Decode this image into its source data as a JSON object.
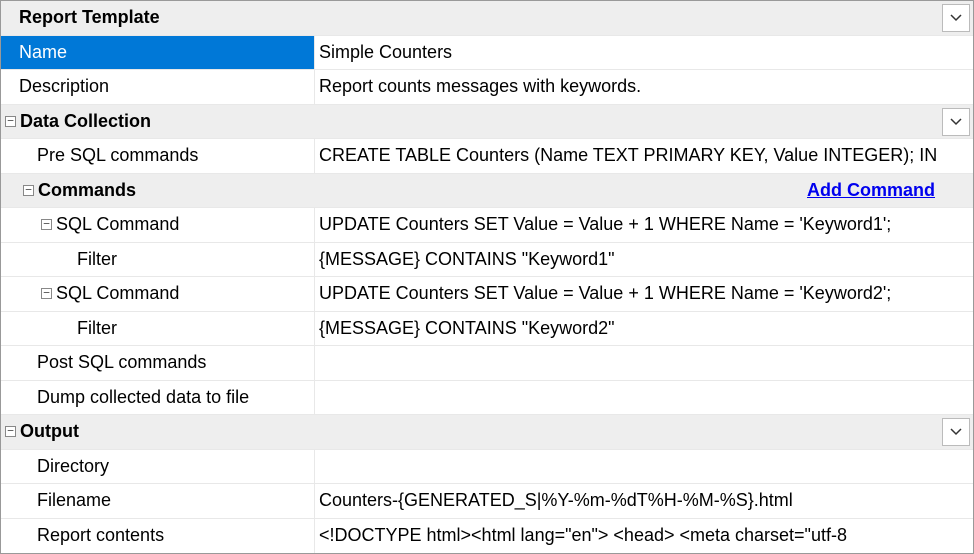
{
  "report_template": {
    "heading": "Report Template",
    "name_label": "Name",
    "name_value": "Simple Counters",
    "description_label": "Description",
    "description_value": "Report counts messages with keywords."
  },
  "data_collection": {
    "heading": "Data Collection",
    "pre_sql_label": "Pre SQL commands",
    "pre_sql_value": "CREATE TABLE Counters (Name TEXT PRIMARY KEY, Value INTEGER); IN",
    "commands_heading": "Commands",
    "add_command_link": "Add Command",
    "commands": [
      {
        "sql_label": "SQL Command",
        "sql_value": "UPDATE Counters SET Value = Value + 1 WHERE Name = 'Keyword1';",
        "filter_label": "Filter",
        "filter_value": "{MESSAGE} CONTAINS \"Keyword1\""
      },
      {
        "sql_label": "SQL Command",
        "sql_value": "UPDATE Counters SET Value = Value + 1 WHERE Name = 'Keyword2';",
        "filter_label": "Filter",
        "filter_value": "{MESSAGE} CONTAINS \"Keyword2\""
      }
    ],
    "post_sql_label": "Post SQL commands",
    "post_sql_value": "",
    "dump_label": "Dump collected data to file",
    "dump_value": ""
  },
  "output": {
    "heading": "Output",
    "directory_label": "Directory",
    "directory_value": "",
    "filename_label": "Filename",
    "filename_value": "Counters-{GENERATED_S|%Y-%m-%dT%H-%M-%S}.html",
    "contents_label": "Report contents",
    "contents_value": "<!DOCTYPE html><html lang=\"en\">   <head>     <meta charset=\"utf-8"
  }
}
